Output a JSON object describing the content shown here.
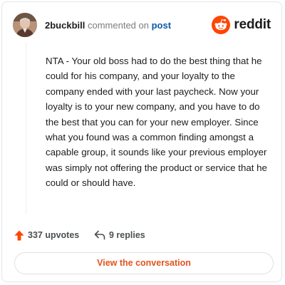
{
  "comment": {
    "username": "2buckbill",
    "action_text": "commented on",
    "target_text": "post",
    "body": "NTA - Your old boss had to do the best thing that he could for his company, and your loyalty to the company ended with your last paycheck. Now your loyalty is to your new company, and you have to do the best that you can for your new employer. Since what you found was a common finding amongst a capable group, it sounds like your previous employer was simply not offering the product or service that he could or should have.",
    "upvotes": "337 upvotes",
    "replies": "9 replies"
  },
  "brand": {
    "wordmark": "reddit",
    "accent": "#FF4500"
  },
  "cta": {
    "label": "View the conversation"
  },
  "icons": {
    "avatar": "user-avatar",
    "logo": "reddit-snoo-icon",
    "upvote": "upvote-arrow-icon",
    "reply": "reply-arrow-icon"
  }
}
